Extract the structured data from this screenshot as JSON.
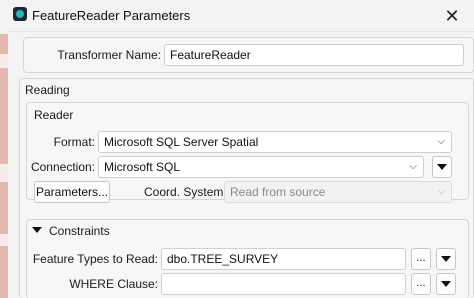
{
  "window": {
    "title": "FeatureReader Parameters",
    "close_icon": "close-icon"
  },
  "general": {
    "transformer_name_label": "Transformer Name:",
    "transformer_name_value": "FeatureReader"
  },
  "reading": {
    "section_label": "Reading",
    "reader": {
      "section_label": "Reader",
      "format_label": "Format:",
      "format_value": "Microsoft SQL Server Spatial",
      "connection_label": "Connection:",
      "connection_value": "Microsoft SQL",
      "parameters_button": "Parameters...",
      "coord_system_label": "Coord. System:",
      "coord_system_placeholder": "Read from source"
    },
    "constraints": {
      "section_label": "Constraints",
      "feature_types_label": "Feature Types to Read:",
      "feature_types_value": "dbo.TREE_SURVEY",
      "where_clause_label": "WHERE Clause:",
      "where_clause_value": "",
      "ellipsis_label": "..."
    }
  },
  "colors": {
    "accent": "#1fb8b6",
    "window_bg": "#f3f3f3",
    "field_bg": "#ffffff"
  }
}
